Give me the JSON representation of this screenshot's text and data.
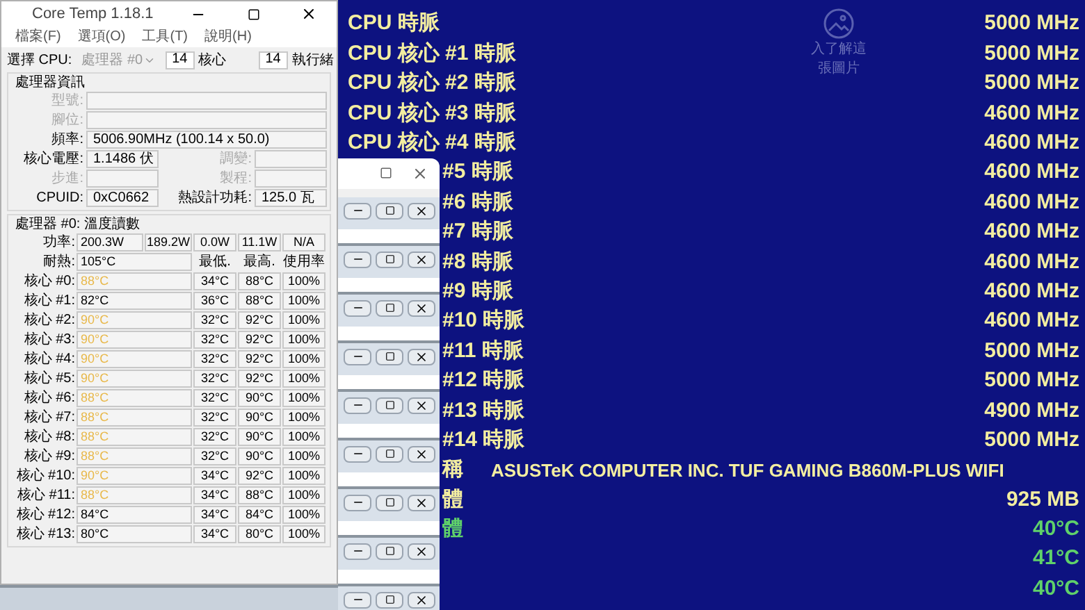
{
  "coretemp": {
    "title": "Core Temp 1.18.1",
    "menu": [
      "檔案(F)",
      "選項(O)",
      "工具(T)",
      "說明(H)"
    ],
    "cpu_select": {
      "label": "選擇 CPU:",
      "value": "處理器 #0",
      "disabled": true
    },
    "cores": {
      "value": "14",
      "label": "核心"
    },
    "threads": {
      "value": "14",
      "label": "執行緒"
    },
    "info": {
      "title": "處理器資訊",
      "model_label": "型號:",
      "socket_label": "腳位:",
      "frequency_label": "頻率:",
      "frequency": "5006.90MHz (100.14 x 50.0)",
      "vid_label": "核心電壓:",
      "vid": "1.1486 伏",
      "modulation_label": "調變:",
      "stepping_label": "步進:",
      "process_label": "製程:",
      "cpuid_label": "CPUID:",
      "cpuid": "0xC0662",
      "tdp_label": "熱設計功耗:",
      "tdp": "125.0 瓦"
    },
    "readings": {
      "title": "處理器 #0: 溫度讀數",
      "power_label": "功率:",
      "power": [
        "200.3W",
        "189.2W",
        "0.0W",
        "11.1W",
        "N/A"
      ],
      "tj_label": "耐熱:",
      "tj": "105°C",
      "columns": [
        "最低.",
        "最高.",
        "使用率"
      ],
      "cores": [
        {
          "label": "核心 #0:",
          "temp": "88°C",
          "hot": true,
          "min": "34°C",
          "max": "88°C",
          "load": "100%"
        },
        {
          "label": "核心 #1:",
          "temp": "82°C",
          "hot": false,
          "min": "36°C",
          "max": "88°C",
          "load": "100%"
        },
        {
          "label": "核心 #2:",
          "temp": "90°C",
          "hot": true,
          "min": "32°C",
          "max": "92°C",
          "load": "100%"
        },
        {
          "label": "核心 #3:",
          "temp": "90°C",
          "hot": true,
          "min": "32°C",
          "max": "92°C",
          "load": "100%"
        },
        {
          "label": "核心 #4:",
          "temp": "90°C",
          "hot": true,
          "min": "32°C",
          "max": "92°C",
          "load": "100%"
        },
        {
          "label": "核心 #5:",
          "temp": "90°C",
          "hot": true,
          "min": "32°C",
          "max": "92°C",
          "load": "100%"
        },
        {
          "label": "核心 #6:",
          "temp": "88°C",
          "hot": true,
          "min": "32°C",
          "max": "90°C",
          "load": "100%"
        },
        {
          "label": "核心 #7:",
          "temp": "88°C",
          "hot": true,
          "min": "32°C",
          "max": "90°C",
          "load": "100%"
        },
        {
          "label": "核心 #8:",
          "temp": "88°C",
          "hot": true,
          "min": "32°C",
          "max": "90°C",
          "load": "100%"
        },
        {
          "label": "核心 #9:",
          "temp": "88°C",
          "hot": true,
          "min": "32°C",
          "max": "90°C",
          "load": "100%"
        },
        {
          "label": "核心 #10:",
          "temp": "90°C",
          "hot": true,
          "min": "34°C",
          "max": "92°C",
          "load": "100%"
        },
        {
          "label": "核心 #11:",
          "temp": "88°C",
          "hot": true,
          "min": "34°C",
          "max": "88°C",
          "load": "100%"
        },
        {
          "label": "核心 #12:",
          "temp": "84°C",
          "hot": false,
          "min": "34°C",
          "max": "84°C",
          "load": "100%"
        },
        {
          "label": "核心 #13:",
          "temp": "80°C",
          "hot": false,
          "min": "34°C",
          "max": "80°C",
          "load": "100%"
        }
      ]
    }
  },
  "overlay": {
    "spotlight_text": "入了解這張圖片",
    "rows": [
      {
        "kind": "metric",
        "label": "CPU 時脈",
        "value": "5000 MHz"
      },
      {
        "kind": "metric",
        "label": "CPU 核心 #1 時脈",
        "value": "5000 MHz"
      },
      {
        "kind": "metric",
        "label": "CPU 核心 #2 時脈",
        "value": "5000 MHz"
      },
      {
        "kind": "metric",
        "label": "CPU 核心 #3 時脈",
        "value": "4600 MHz"
      },
      {
        "kind": "metric",
        "label": "CPU 核心 #4 時脈",
        "value": "4600 MHz"
      },
      {
        "kind": "metric",
        "label": "#5 時脈",
        "value": "4600 MHz"
      },
      {
        "kind": "metric",
        "label": "#6 時脈",
        "value": "4600 MHz"
      },
      {
        "kind": "metric",
        "label": "#7 時脈",
        "value": "4600 MHz"
      },
      {
        "kind": "metric",
        "label": "#8 時脈",
        "value": "4600 MHz"
      },
      {
        "kind": "metric",
        "label": "#9 時脈",
        "value": "4600 MHz"
      },
      {
        "kind": "metric",
        "label": "#10 時脈",
        "value": "4600 MHz"
      },
      {
        "kind": "metric",
        "label": "#11 時脈",
        "value": "5000 MHz"
      },
      {
        "kind": "metric",
        "label": "#12 時脈",
        "value": "5000 MHz"
      },
      {
        "kind": "metric",
        "label": "#13 時脈",
        "value": "4900 MHz"
      },
      {
        "kind": "metric",
        "label": "#14 時脈",
        "value": "5000 MHz"
      },
      {
        "kind": "name",
        "label": "稱",
        "value": "ASUSTeK COMPUTER INC. TUF GAMING B860M-PLUS WIFI"
      },
      {
        "kind": "metric",
        "label": "體",
        "value": "925 MB"
      },
      {
        "kind": "temp",
        "label": "體",
        "value": "40°C"
      },
      {
        "kind": "temp",
        "value": "41°C"
      },
      {
        "kind": "temp",
        "value": "40°C"
      }
    ]
  }
}
